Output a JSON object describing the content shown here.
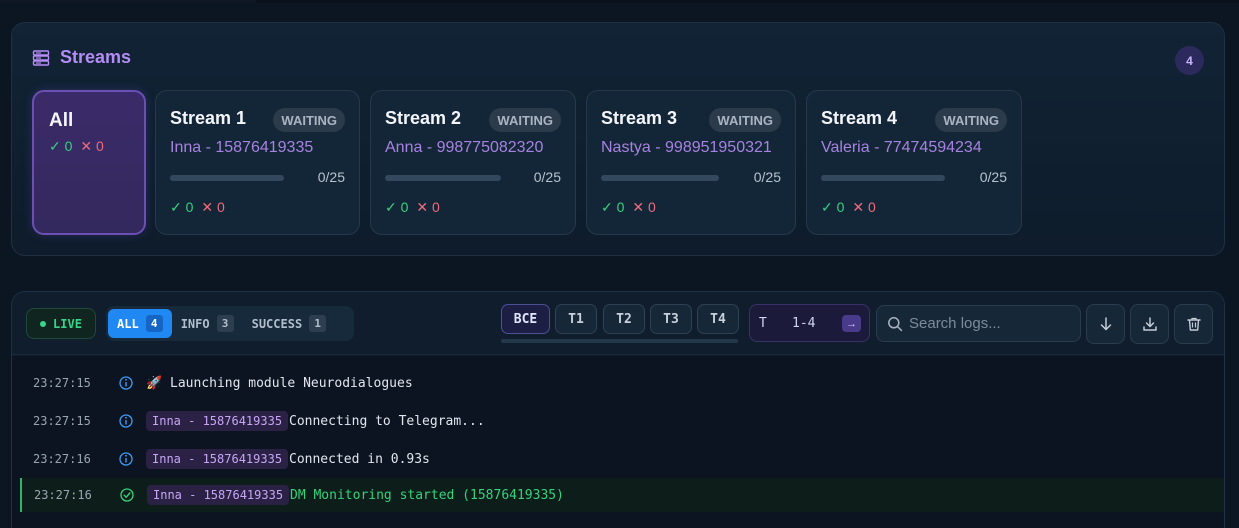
{
  "streams": {
    "title": "Streams",
    "count": "4",
    "all_card": {
      "label": "All",
      "ok": "0",
      "fail": "0"
    },
    "cards": [
      {
        "title": "Stream 1",
        "status": "WAITING",
        "account": "Inna - 15876419335",
        "progress": "0/25",
        "progress_fraction": 0,
        "ok": "0",
        "fail": "0"
      },
      {
        "title": "Stream 2",
        "status": "WAITING",
        "account": "Anna - 998775082320",
        "progress": "0/25",
        "progress_fraction": 0,
        "ok": "0",
        "fail": "0"
      },
      {
        "title": "Stream 3",
        "status": "WAITING",
        "account": "Nastya - 998951950321",
        "progress": "0/25",
        "progress_fraction": 0,
        "ok": "0",
        "fail": "0"
      },
      {
        "title": "Stream 4",
        "status": "WAITING",
        "account": "Valeria - 77474594234",
        "progress": "0/25",
        "progress_fraction": 0,
        "ok": "0",
        "fail": "0"
      }
    ]
  },
  "logs": {
    "live_label": "LIVE",
    "filters": [
      {
        "label": "ALL",
        "count": "4",
        "active": true
      },
      {
        "label": "INFO",
        "count": "3",
        "active": false
      },
      {
        "label": "SUCCESS",
        "count": "1",
        "active": false
      }
    ],
    "threads": [
      {
        "label": "ВСЕ",
        "active": true
      },
      {
        "label": "T1",
        "active": false
      },
      {
        "label": "T2",
        "active": false
      },
      {
        "label": "T3",
        "active": false
      },
      {
        "label": "T4",
        "active": false
      }
    ],
    "range": {
      "prefix": "T",
      "value": "1-4",
      "arrow": "→"
    },
    "search_placeholder": "Search logs...",
    "entries": [
      {
        "time": "23:27:15",
        "level": "info",
        "tag": "",
        "message": "🚀 Launching module Neurodialogues"
      },
      {
        "time": "23:27:15",
        "level": "info",
        "tag": "Inna - 15876419335",
        "message": "Connecting to Telegram..."
      },
      {
        "time": "23:27:16",
        "level": "info",
        "tag": "Inna - 15876419335",
        "message": "Connected in 0.93s"
      },
      {
        "time": "23:27:16",
        "level": "success",
        "tag": "Inna - 15876419335",
        "message": "DM Monitoring started (15876419335)"
      }
    ]
  },
  "icons": {
    "check": "✓",
    "cross": "✕"
  },
  "colors": {
    "accent_purple": "#b48cf5",
    "active_blue": "#1f88f2",
    "success_green": "#35d07f",
    "fail_red": "#f06a7a"
  }
}
